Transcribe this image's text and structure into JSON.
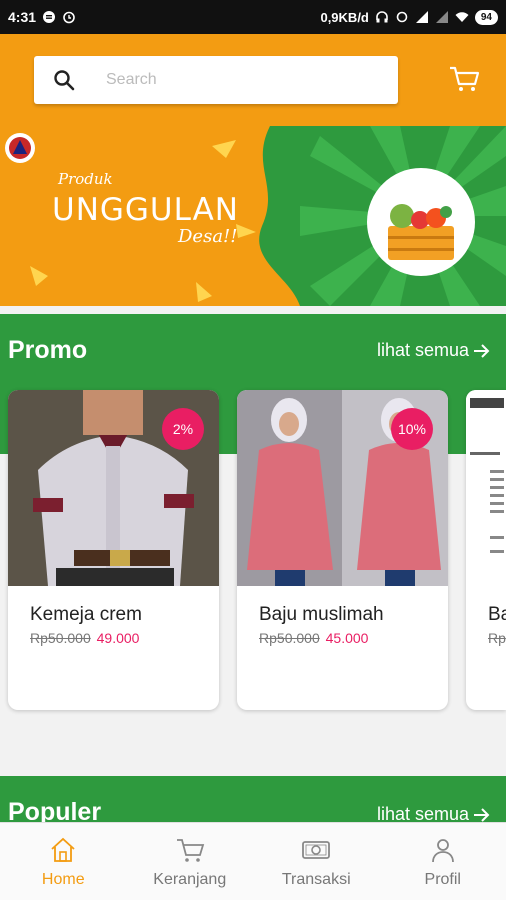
{
  "status_bar": {
    "time": "4:31",
    "network_speed": "0,9KB/d",
    "battery": "94"
  },
  "search": {
    "placeholder": "Search"
  },
  "banner": {
    "line1": "Produk",
    "line2": "UNGGULAN",
    "line3": "Desa!!",
    "active_slide": 2,
    "slides": 3
  },
  "promo": {
    "title": "Promo",
    "see_all": "lihat semua",
    "products": [
      {
        "name": "Kemeja crem",
        "currency": "Rp",
        "old_price": "50.000",
        "new_price": "49.000",
        "discount": "2%"
      },
      {
        "name": "Baju muslimah",
        "currency": "Rp",
        "old_price": "50.000",
        "new_price": "45.000",
        "discount": "10%"
      },
      {
        "name": "Ba",
        "currency": "Rp",
        "old_price": "",
        "new_price": "",
        "discount": ""
      }
    ]
  },
  "populer": {
    "title": "Populer",
    "see_all": "lihat semua"
  },
  "bottom_nav": {
    "items": [
      {
        "label": "Home",
        "icon": "home-icon",
        "active": true
      },
      {
        "label": "Keranjang",
        "icon": "cart-icon",
        "active": false
      },
      {
        "label": "Transaksi",
        "icon": "money-icon",
        "active": false
      },
      {
        "label": "Profil",
        "icon": "person-icon",
        "active": false
      }
    ]
  },
  "colors": {
    "accent_orange": "#f39c12",
    "section_green": "#2e9a3e",
    "price_pink": "#e91e63"
  }
}
